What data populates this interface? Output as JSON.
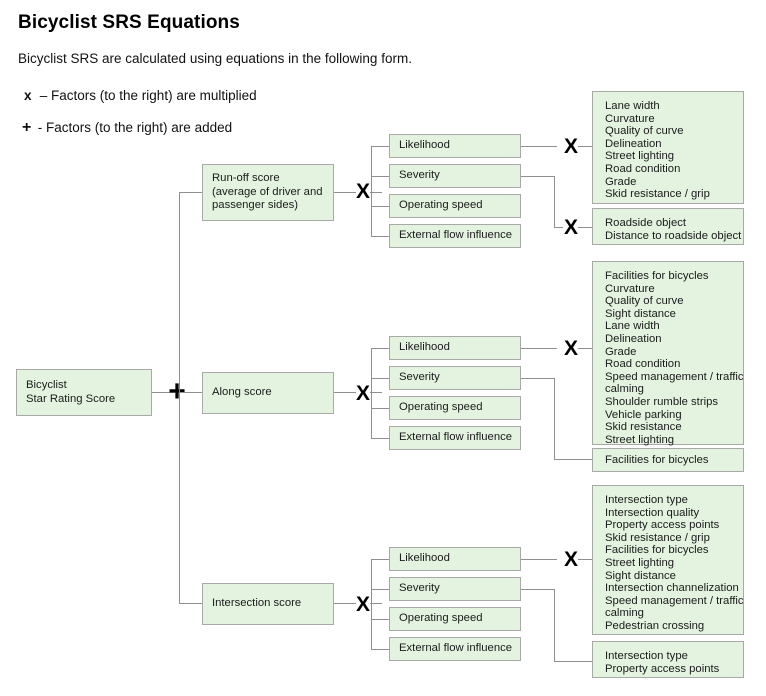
{
  "header": {
    "title": "Bicyclist SRS Equations",
    "intro": "Bicyclist SRS are calculated using equations in the following form.",
    "legend": [
      {
        "symbol": "x",
        "text": "– Factors (to the right) are multiplied"
      },
      {
        "symbol": "+",
        "text": "- Factors (to the right) are added"
      }
    ]
  },
  "operators": {
    "multiply": "X",
    "add": "+"
  },
  "root": {
    "line1": "Bicyclist",
    "line2": "Star Rating Score"
  },
  "branches": [
    {
      "id": "run-off",
      "score_lines": [
        "Run-off score",
        "(average of driver and",
        "passenger sides)"
      ],
      "components": [
        "Likelihood",
        "Severity",
        "Operating speed",
        "External flow influence"
      ],
      "factor_lists": [
        {
          "id": "run-off-likelihood-factors",
          "items": [
            "Lane width",
            "Curvature",
            "Quality of curve",
            "Delineation",
            "Street lighting",
            "Road condition",
            "Grade",
            "Skid resistance / grip"
          ]
        },
        {
          "id": "run-off-severity-factors",
          "items": [
            "Roadside object",
            "Distance to roadside object"
          ]
        }
      ]
    },
    {
      "id": "along",
      "score_lines": [
        "Along score"
      ],
      "components": [
        "Likelihood",
        "Severity",
        "Operating speed",
        "External flow influence"
      ],
      "factor_lists": [
        {
          "id": "along-likelihood-factors",
          "items": [
            "Facilities for bicycles",
            "Curvature",
            "Quality of curve",
            "Sight distance",
            "Lane width",
            "Delineation",
            "Grade",
            "Road condition",
            "Speed management / traffic",
            "calming",
            "Shoulder rumble strips",
            "Vehicle parking",
            "Skid resistance",
            "Street lighting"
          ]
        },
        {
          "id": "along-severity-factors",
          "items": [
            "Facilities for bicycles"
          ]
        }
      ]
    },
    {
      "id": "intersection",
      "score_lines": [
        "Intersection score"
      ],
      "components": [
        "Likelihood",
        "Severity",
        "Operating speed",
        "External flow influence"
      ],
      "factor_lists": [
        {
          "id": "intersection-likelihood-factors",
          "items": [
            "Intersection type",
            "Intersection quality",
            "Property access points",
            "Skid resistance / grip",
            "Facilities for bicycles",
            "Street lighting",
            "Sight distance",
            "Intersection channelization",
            "Speed management / traffic",
            "calming",
            "Pedestrian crossing"
          ]
        },
        {
          "id": "intersection-severity-factors",
          "items": [
            "Intersection type",
            "Property access points"
          ]
        }
      ]
    }
  ],
  "colors": {
    "box_fill": "#e3f3e0",
    "box_border": "#a9a9a9",
    "connector": "#8f8f8f",
    "text": "#1b1b1b"
  }
}
